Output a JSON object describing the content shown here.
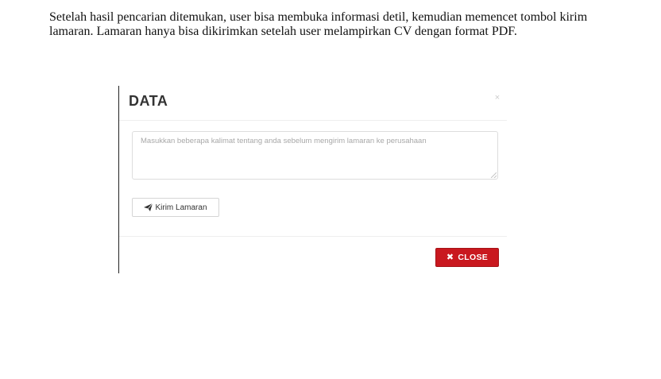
{
  "document": {
    "paragraph": "Setelah hasil pencarian ditemukan, user bisa membuka informasi detil, kemudian memencet tombol kirim lamaran. Lamaran hanya bisa dikirimkan setelah user melampirkan CV dengan format PDF."
  },
  "modal": {
    "title": "DATA",
    "close_x": "×",
    "message": {
      "placeholder": "Masukkan beberapa kalimat tentang anda sebelum mengirim lamaran ke perusahaan",
      "value": ""
    },
    "send_button": {
      "label": "Kirim Lamaran",
      "icon": "send-icon"
    },
    "footer": {
      "close_label": "CLOSE",
      "close_icon_glyph": "✖",
      "close_icon": "close-icon"
    }
  },
  "colors": {
    "close_button_bg": "#c9181f",
    "title_text": "#333333"
  }
}
